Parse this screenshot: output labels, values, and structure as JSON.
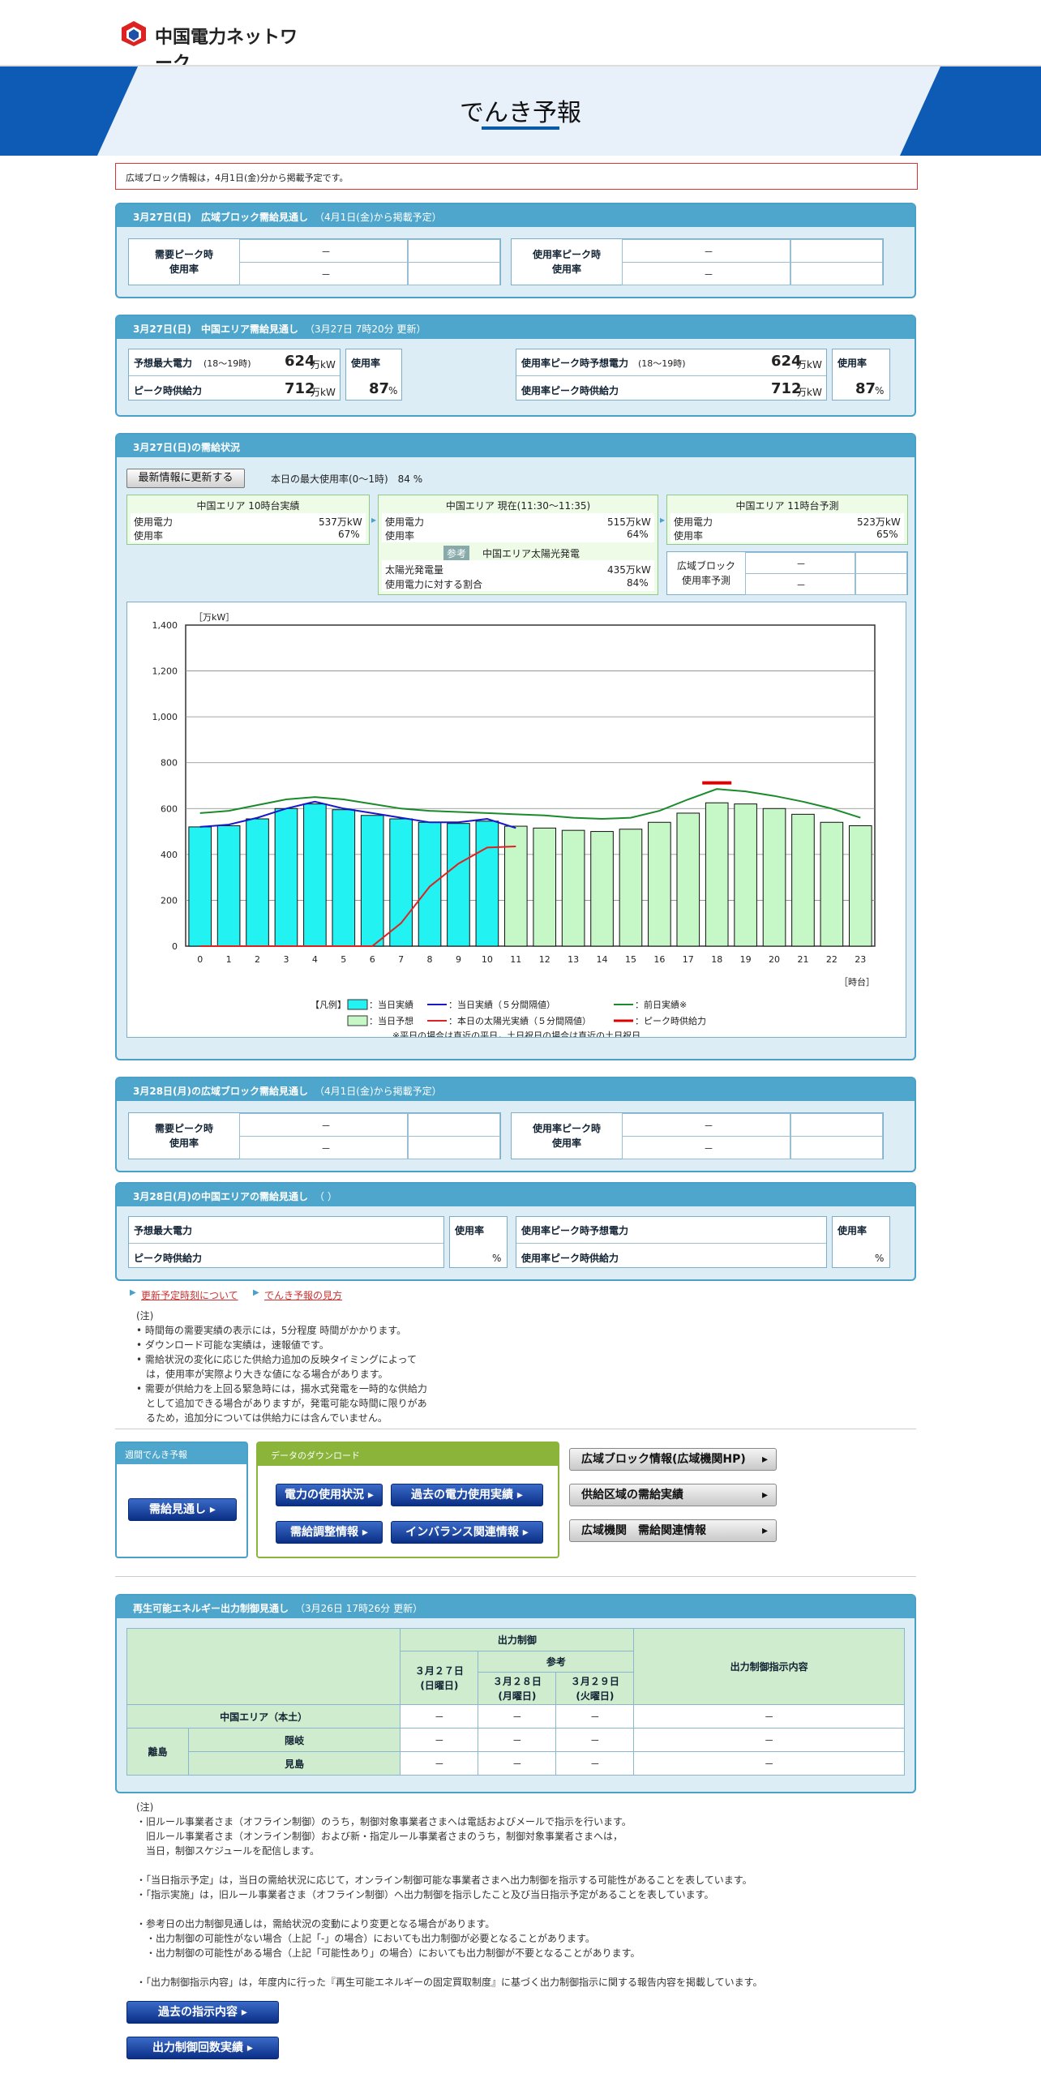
{
  "logo_text": "中国電力ネットワーク",
  "page_title": "でんき予報",
  "notice": "広域ブロック情報は，4月1日(金)分から掲載予定です。",
  "wide_today": {
    "title": "3月27日(日)　広域ブロック需給見通し",
    "sub": "（4月1日(金)から掲載予定）",
    "peak_label": "需要ピーク時\n使用率",
    "peak_label1": "需要ピーク時",
    "peak_label2": "使用率",
    "rate_label1": "使用率ピーク時",
    "rate_label2": "使用率",
    "dash": "－"
  },
  "area_today": {
    "title": "3月27日(日)　中国エリア需給見通し",
    "sub": "（3月27日 7時20分 更新）",
    "max_label": "予想最大電力",
    "max_range": "(18～19時)",
    "max_val": "624",
    "unit": "万kW",
    "supply_label": "ピーク時供給力",
    "supply_val": "712",
    "rate_label": "使用率",
    "rate_val": "87",
    "pct": "%",
    "rpk_label": "使用率ピーク時予想電力",
    "rpk_range": "(18～19時)",
    "rpk_val": "624",
    "rsup_label": "使用率ピーク時供給力",
    "rsup_val": "712",
    "rrate_val": "87"
  },
  "status": {
    "title": "3月27日(日)の需給状況",
    "refresh_btn": "最新情報に更新する",
    "max_rate": "本日の最大使用率(0～1時)　84 %",
    "box1": {
      "title": "中国エリア 10時台実績",
      "l1": "使用電力",
      "v1": "537万kW",
      "l2": "使用率",
      "v2": "67%"
    },
    "box2": {
      "title": "中国エリア 現在(11:30～11:35)",
      "l1": "使用電力",
      "v1": "515万kW",
      "l2": "使用率",
      "v2": "64%",
      "tag": "参考",
      "sub": "中国エリア太陽光発電",
      "l3": "太陽光発電量",
      "v3": "435万kW",
      "l4": "使用電力に対する割合",
      "v4": "84%"
    },
    "box3": {
      "title": "中国エリア 11時台予測",
      "l1": "使用電力",
      "v1": "523万kW",
      "l2": "使用率",
      "v2": "65%"
    },
    "box4": {
      "l1": "広域ブロック",
      "l2": "使用率予測",
      "dash": "－"
    }
  },
  "chart_data": {
    "type": "bar",
    "yunit": "［万kW］",
    "xunit": "［時台］",
    "ylim": [
      0,
      1400
    ],
    "yticks": [
      "0",
      "200",
      "400",
      "600",
      "800",
      "1,000",
      "1,200",
      "1,400"
    ],
    "categories": [
      "0",
      "1",
      "2",
      "3",
      "4",
      "5",
      "6",
      "7",
      "8",
      "9",
      "10",
      "11",
      "12",
      "13",
      "14",
      "15",
      "16",
      "17",
      "18",
      "19",
      "20",
      "21",
      "22",
      "23"
    ],
    "actual": [
      520,
      525,
      555,
      600,
      620,
      595,
      570,
      555,
      540,
      535,
      545,
      null,
      null,
      null,
      null,
      null,
      null,
      null,
      null,
      null,
      null,
      null,
      null,
      null
    ],
    "forecast": [
      null,
      null,
      null,
      null,
      null,
      null,
      null,
      null,
      null,
      null,
      null,
      523,
      515,
      505,
      500,
      510,
      540,
      580,
      625,
      620,
      600,
      575,
      540,
      525
    ],
    "prev_day": [
      580,
      590,
      615,
      640,
      650,
      640,
      620,
      600,
      590,
      585,
      580,
      575,
      570,
      560,
      555,
      560,
      590,
      640,
      685,
      675,
      655,
      630,
      600,
      560
    ],
    "five_min": [
      520,
      530,
      560,
      600,
      630,
      600,
      580,
      560,
      540,
      540,
      555,
      515
    ],
    "solar": [
      0,
      0,
      0,
      0,
      0,
      0,
      0,
      100,
      260,
      360,
      430,
      435
    ],
    "peak_supply": {
      "x": 18,
      "y": 712
    },
    "legend": {
      "head": "【凡例】",
      "a": "：当日実績",
      "b": "：当日予想",
      "c": "：当日実績（５分間隔値）",
      "d": "：本日の太陽光実績（５分間隔値）",
      "e": "：前日実績※",
      "f": "：ピーク時供給力"
    },
    "footnote": "※平日の場合は直近の平日，土日祝日の場合は直近の土日祝日"
  },
  "wide_tomorrow": {
    "title": "3月28日(月)の広域ブロック需給見通し",
    "sub": "（4月1日(金)から掲載予定）"
  },
  "area_tomorrow": {
    "title": "3月28日(月)の中国エリアの需給見通し",
    "sub": "（ ）",
    "max_label": "予想最大電力",
    "supply_label": "ピーク時供給力",
    "rate_label": "使用率",
    "rpk_label": "使用率ピーク時予想電力",
    "rsup_label": "使用率ピーク時供給力",
    "pct": "%"
  },
  "links": {
    "l1": "更新予定時刻について",
    "l2": "でんき予報の見方"
  },
  "notes1": [
    "(注)",
    "時間毎の需要実績の表示には，5分程度 時間がかかります。",
    "ダウンロード可能な実績は，速報値です。",
    "需給状況の変化に応じた供給力追加の反映タイミングによって",
    "は，使用率が実際より大きな値になる場合があります。",
    "需要が供給力を上回る緊急時には，揚水式発電を一時的な供給力",
    "として追加できる場合がありますが，発電可能な時間に限りがあ",
    "るため，追加分については供給力には含んでいません。"
  ],
  "weekly": {
    "title": "週間でんき予報",
    "btn": "需給見通し"
  },
  "download": {
    "title": "データのダウンロード",
    "b1": "電力の使用状況",
    "b2": "過去の電力使用実績",
    "b3": "需給調整情報",
    "b4": "インバランス関連情報"
  },
  "side_btns": [
    "広域ブロック情報(広域機関HP)",
    "供給区域の需給実績",
    "広域機関　需給関連情報"
  ],
  "renew": {
    "title": "再生可能エネルギー出力制御見通し",
    "sub": "（3月26日 17時26分 更新）",
    "h_ctrl": "出力制御",
    "h_ref": "参考",
    "d1a": "３月２７日",
    "d1b": "(日曜日)",
    "d2a": "３月２８日",
    "d2b": "(月曜日)",
    "d3a": "３月２９日",
    "d3b": "(火曜日)",
    "h_content": "出力制御指示内容",
    "r1": "中国エリア（本土）",
    "r2": "離島",
    "r2a": "隠岐",
    "r2b": "見島",
    "dash": "－"
  },
  "notes2": [
    "(注)",
    "・旧ルール事業者さま（オフライン制御）のうち，制御対象事業者さまへは電話およびメールで指示を行います。",
    "　旧ルール事業者さま（オンライン制御）および新・指定ルール事業者さまのうち，制御対象事業者さまへは，",
    "　当日，制御スケジュールを配信します。",
    "",
    "・「当日指示予定」は，当日の需給状況に応じて，オンライン制御可能な事業者さまへ出力制御を指示する可能性があることを表しています。",
    "・「指示実施」は，旧ルール事業者さま（オフライン制御）へ出力制御を指示したこと及び当日指示予定があることを表しています。",
    "",
    "・参考日の出力制御見通しは，需給状況の変動により変更となる場合があります。",
    "　・出力制御の可能性がない場合（上記「-」の場合）においても出力制御が必要となることがあります。",
    "　・出力制御の可能性がある場合（上記「可能性あり」の場合）においても出力制御が不要となることがあります。",
    "",
    "・「出力制御指示内容」は，年度内に行った『再生可能エネルギーの固定買取制度』に基づく出力制御指示に関する報告内容を掲載しています。"
  ],
  "bottom_btns": [
    "過去の指示内容",
    "出力制御回数実績"
  ],
  "colors": {
    "accent": "#0a5aa8",
    "panel_head": "#4ea6cc",
    "actual": "#22f2f2",
    "forecast": "#c6f7c6"
  }
}
